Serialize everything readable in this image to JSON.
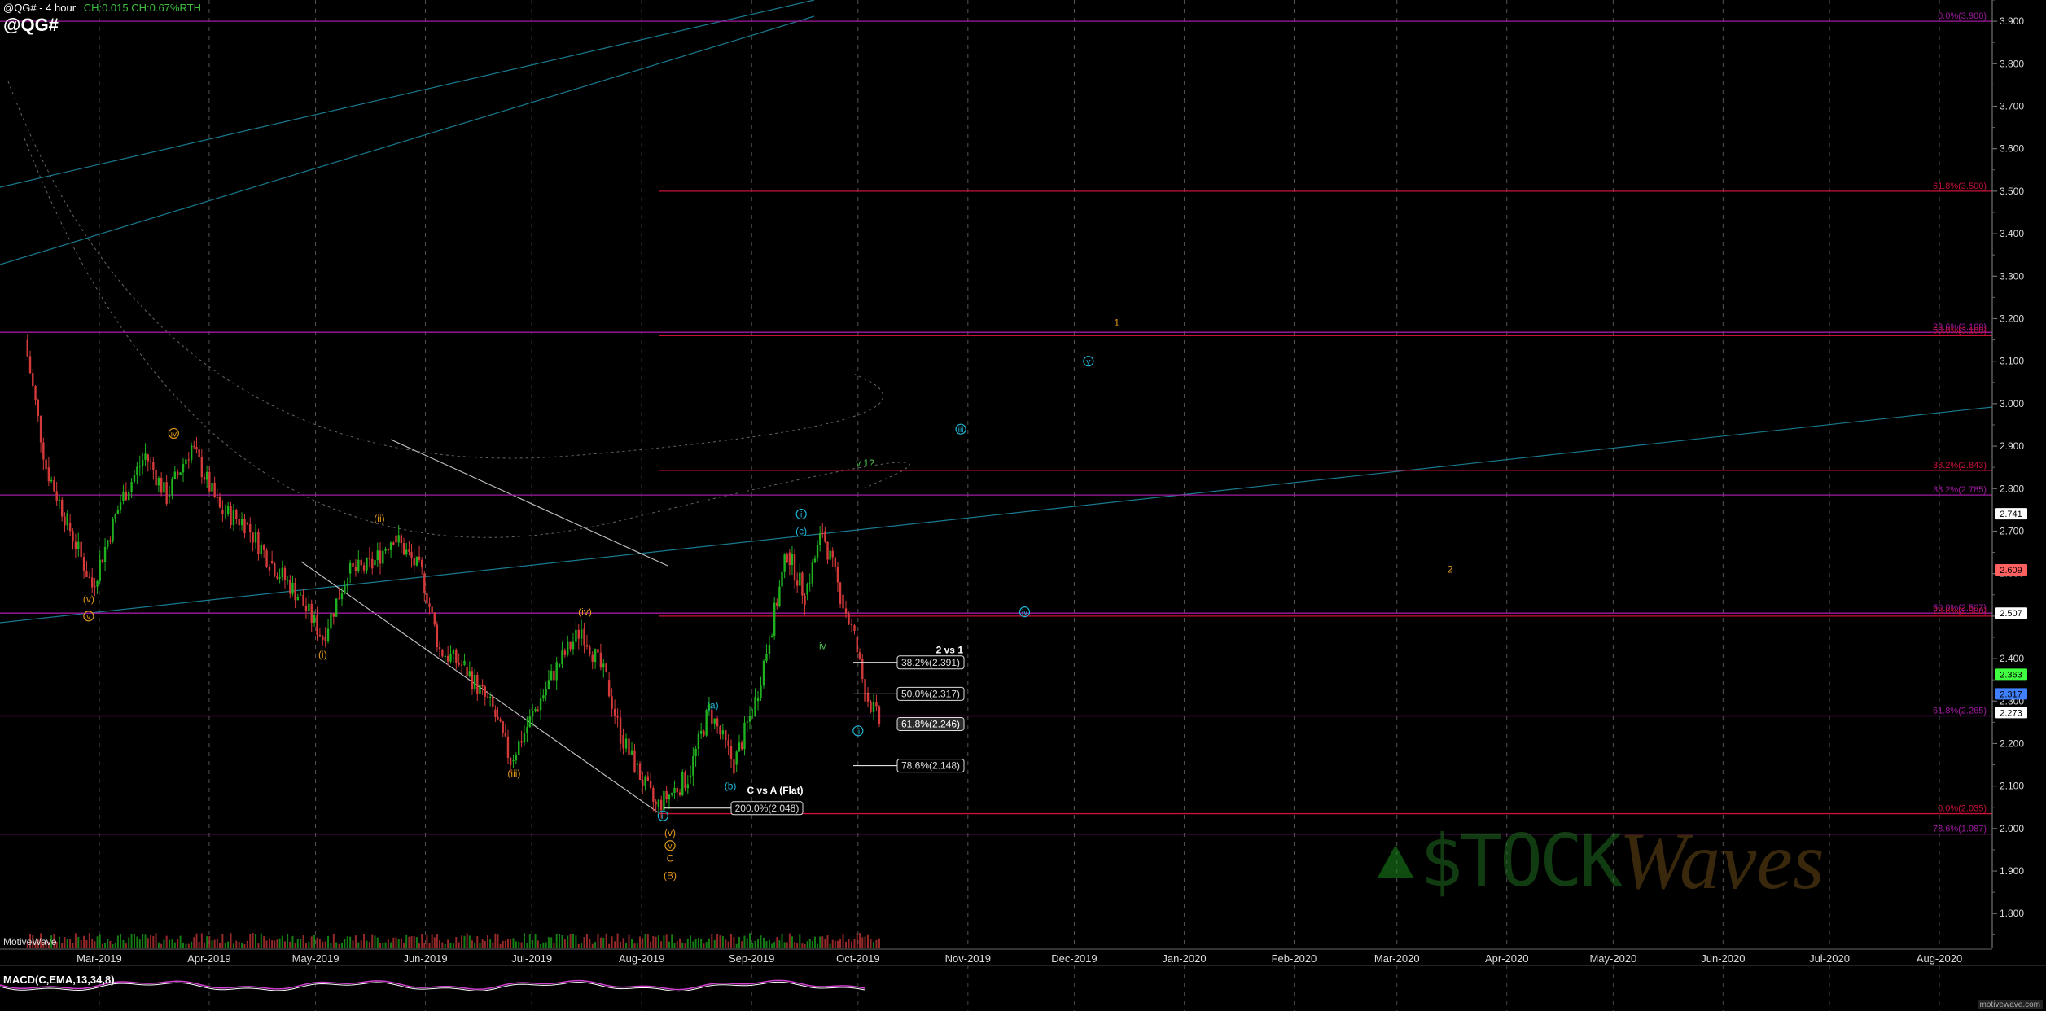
{
  "header": {
    "title": "@QG# - 4 hour",
    "change": "CH:0.015 CH:0.67%RTH",
    "symbol": "@QG#",
    "source": "MotiveWave",
    "indicator": "MACD(C,EMA,13,34,8)",
    "footer": "motivewave.com",
    "watermark_left": "$TOCK",
    "watermark_right": "Waves"
  },
  "colors": {
    "background": "#000000",
    "grid": "#9a9a9a",
    "up_candle": "#1fb11f",
    "down_candle": "#d43a3a",
    "fib_red": "#c8123a",
    "fib_purple": "#a01aa0",
    "trend_blue": "#1f8fa8",
    "wave_orange": "#e29a1c",
    "wave_cyan": "#1fb8d8",
    "wave_green": "#4cc04c"
  },
  "chart_data": {
    "type": "candlestick",
    "title": "@QG# - 4 hour",
    "ylim": [
      1.72,
      3.95
    ],
    "y_ticks": [
      "1.800",
      "1.900",
      "2.000",
      "2.100",
      "2.200",
      "2.300",
      "2.400",
      "2.500",
      "2.600",
      "2.700",
      "2.800",
      "2.900",
      "3.000",
      "3.100",
      "3.200",
      "3.300",
      "3.400",
      "3.500",
      "3.600",
      "3.700",
      "3.800",
      "3.900"
    ],
    "x_ticks": [
      "Mar-2019",
      "Apr-2019",
      "May-2019",
      "Jun-2019",
      "Jul-2019",
      "Aug-2019",
      "Sep-2019",
      "Oct-2019",
      "Nov-2019",
      "Dec-2019",
      "Jan-2020",
      "Feb-2020",
      "Mar-2020",
      "Apr-2020",
      "May-2020",
      "Jun-2020",
      "Jul-2020",
      "Aug-2020"
    ],
    "price_path": [
      [
        "2019-02-08",
        3.15
      ],
      [
        "2019-02-14",
        2.85
      ],
      [
        "2019-02-20",
        2.72
      ],
      [
        "2019-02-27",
        2.57
      ],
      [
        "2019-03-07",
        2.77
      ],
      [
        "2019-03-14",
        2.88
      ],
      [
        "2019-03-20",
        2.78
      ],
      [
        "2019-03-27",
        2.9
      ],
      [
        "2019-04-04",
        2.75
      ],
      [
        "2019-04-11",
        2.72
      ],
      [
        "2019-04-18",
        2.63
      ],
      [
        "2019-04-26",
        2.55
      ],
      [
        "2019-05-03",
        2.45
      ],
      [
        "2019-05-10",
        2.6
      ],
      [
        "2019-05-17",
        2.62
      ],
      [
        "2019-05-23",
        2.69
      ],
      [
        "2019-05-31",
        2.6
      ],
      [
        "2019-06-05",
        2.42
      ],
      [
        "2019-06-12",
        2.38
      ],
      [
        "2019-06-20",
        2.28
      ],
      [
        "2019-06-25",
        2.16
      ],
      [
        "2019-07-02",
        2.28
      ],
      [
        "2019-07-08",
        2.38
      ],
      [
        "2019-07-15",
        2.47
      ],
      [
        "2019-07-22",
        2.35
      ],
      [
        "2019-07-26",
        2.22
      ],
      [
        "2019-07-30",
        2.15
      ],
      [
        "2019-08-05",
        2.05
      ],
      [
        "2019-08-14",
        2.12
      ],
      [
        "2019-08-20",
        2.28
      ],
      [
        "2019-08-27",
        2.15
      ],
      [
        "2019-09-02",
        2.3
      ],
      [
        "2019-09-06",
        2.45
      ],
      [
        "2019-09-11",
        2.65
      ],
      [
        "2019-09-16",
        2.55
      ],
      [
        "2019-09-21",
        2.7
      ],
      [
        "2019-09-26",
        2.55
      ],
      [
        "2019-09-30",
        2.45
      ],
      [
        "2019-10-03",
        2.32
      ],
      [
        "2019-10-07",
        2.25
      ]
    ],
    "last_price": 2.273,
    "price_tags": [
      {
        "value": 2.741,
        "text": "2.741",
        "color": "#ffffff"
      },
      {
        "value": 2.609,
        "text": "2.609",
        "color": "#ff6060"
      },
      {
        "value": 2.507,
        "text": "2.507",
        "color": "#ffffff"
      },
      {
        "value": 2.363,
        "text": "2.363",
        "color": "#40ff40"
      },
      {
        "value": 2.317,
        "text": "2.317",
        "color": "#4080ff"
      },
      {
        "value": 2.273,
        "text": "2.273",
        "color": "#ffffff"
      }
    ],
    "fib_levels": [
      {
        "value": 3.9,
        "label": "0.0%(3.900)",
        "color": "#a01aa0"
      },
      {
        "value": 3.5,
        "label": "61.8%(3.500)",
        "color": "#c8123a"
      },
      {
        "value": 3.168,
        "label": "23.6%(3.168)",
        "color": "#a01aa0"
      },
      {
        "value": 3.16,
        "label": "50.0%(3.160)",
        "color": "#c8123a"
      },
      {
        "value": 2.843,
        "label": "38.2%(2.843)",
        "color": "#c8123a"
      },
      {
        "value": 2.785,
        "label": "38.2%(2.785)",
        "color": "#a01aa0"
      },
      {
        "value": 2.507,
        "label": "50.0%(2.507)",
        "color": "#a01aa0"
      },
      {
        "value": 2.5,
        "label": "23.6%(2.500)",
        "color": "#c8123a"
      },
      {
        "value": 2.265,
        "label": "61.8%(2.265)",
        "color": "#a01aa0"
      },
      {
        "value": 2.035,
        "label": "0.0%(2.035)",
        "color": "#c8123a"
      },
      {
        "value": 1.987,
        "label": "78.6%(1.987)",
        "color": "#a01aa0"
      }
    ],
    "fib_projection": {
      "title": "2 vs 1",
      "boxes": [
        {
          "value": 2.391,
          "text": "38.2%(2.391)"
        },
        {
          "value": 2.317,
          "text": "50.0%(2.317)"
        },
        {
          "value": 2.246,
          "text": "61.8%(2.246)",
          "highlight": true
        },
        {
          "value": 2.148,
          "text": "78.6%(2.148)"
        }
      ]
    },
    "flat_projection": {
      "title": "C vs A (Flat)",
      "value": 2.048,
      "text": "200.0%(2.048)"
    },
    "wave_labels": [
      {
        "date": "2019-03-22",
        "value": 2.93,
        "text": "iv",
        "color": "#e29a1c",
        "circle": true
      },
      {
        "date": "2019-02-26",
        "value": 2.54,
        "text": "(v)",
        "color": "#e29a1c"
      },
      {
        "date": "2019-02-26",
        "value": 2.5,
        "text": "v",
        "color": "#e29a1c",
        "circle": true
      },
      {
        "date": "2019-05-19",
        "value": 2.73,
        "text": "(ii)",
        "color": "#e29a1c"
      },
      {
        "date": "2019-05-03",
        "value": 2.41,
        "text": "(i)",
        "color": "#e29a1c"
      },
      {
        "date": "2019-07-16",
        "value": 2.51,
        "text": "(iv)",
        "color": "#e29a1c"
      },
      {
        "date": "2019-06-26",
        "value": 2.13,
        "text": "(iii)",
        "color": "#e29a1c"
      },
      {
        "date": "2019-08-09",
        "value": 1.99,
        "text": "(v)",
        "color": "#e29a1c"
      },
      {
        "date": "2019-08-09",
        "value": 1.96,
        "text": "v",
        "color": "#e29a1c",
        "circle": true
      },
      {
        "date": "2019-08-09",
        "value": 1.93,
        "text": "C",
        "color": "#e29a1c"
      },
      {
        "date": "2019-08-09",
        "value": 1.89,
        "text": "(B)",
        "color": "#e29a1c"
      },
      {
        "date": "2019-08-07",
        "value": 2.03,
        "text": "ii",
        "color": "#1fb8d8",
        "circle": true
      },
      {
        "date": "2019-08-21",
        "value": 2.29,
        "text": "(a)",
        "color": "#1fb8d8"
      },
      {
        "date": "2019-08-26",
        "value": 2.1,
        "text": "(b)",
        "color": "#1fb8d8"
      },
      {
        "date": "2019-09-15",
        "value": 2.74,
        "text": "i",
        "color": "#1fb8d8",
        "circle": true
      },
      {
        "date": "2019-09-15",
        "value": 2.7,
        "text": "(c)",
        "color": "#1fb8d8"
      },
      {
        "date": "2019-09-21",
        "value": 2.43,
        "text": "iv",
        "color": "#4cc04c"
      },
      {
        "date": "2019-10-03",
        "value": 2.86,
        "text": "v 1?",
        "color": "#4cc04c"
      },
      {
        "date": "2019-10-01",
        "value": 2.23,
        "text": "ii",
        "color": "#1fb8d8",
        "circle": true
      },
      {
        "date": "2019-10-30",
        "value": 2.94,
        "text": "iii",
        "color": "#1fb8d8",
        "circle": true
      },
      {
        "date": "2019-11-17",
        "value": 2.51,
        "text": "iv",
        "color": "#1fb8d8",
        "circle": true
      },
      {
        "date": "2019-12-05",
        "value": 3.1,
        "text": "v",
        "color": "#1fb8d8",
        "circle": true
      },
      {
        "date": "2019-12-13",
        "value": 3.19,
        "text": "1",
        "color": "#e29a1c"
      },
      {
        "date": "2020-03-16",
        "value": 2.61,
        "text": "2",
        "color": "#e29a1c"
      }
    ]
  }
}
